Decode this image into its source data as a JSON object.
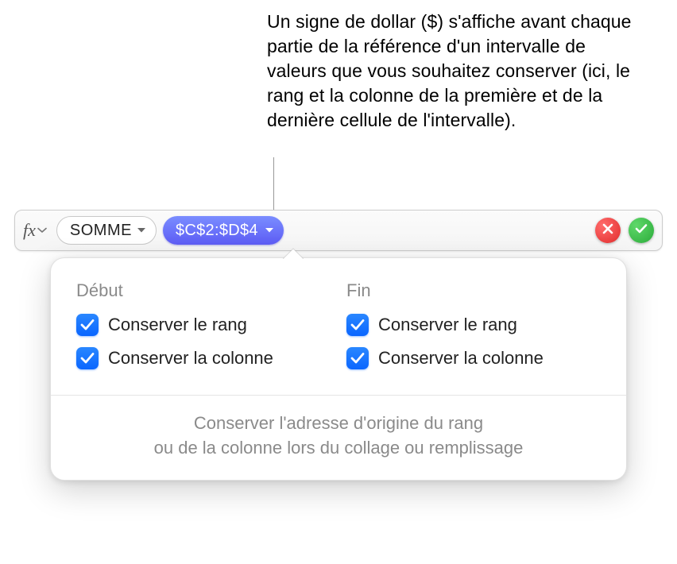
{
  "annotation": "Un signe de dollar ($) s'affiche avant chaque partie de la référence d'un intervalle de valeurs que vous souhaitez conserver (ici, le rang et la colonne de la première et de la dernière cellule de l'intervalle).",
  "formula_bar": {
    "fx_label": "fx",
    "function_name": "SOMME",
    "range_reference": "$C$2:$D$4"
  },
  "popover": {
    "start": {
      "header": "Début",
      "preserve_row": "Conserver le rang",
      "preserve_column": "Conserver la colonne"
    },
    "end": {
      "header": "Fin",
      "preserve_row": "Conserver le rang",
      "preserve_column": "Conserver la colonne"
    },
    "footer_line1": "Conserver l'adresse d'origine du rang",
    "footer_line2": "ou de la colonne lors du collage ou remplissage"
  }
}
